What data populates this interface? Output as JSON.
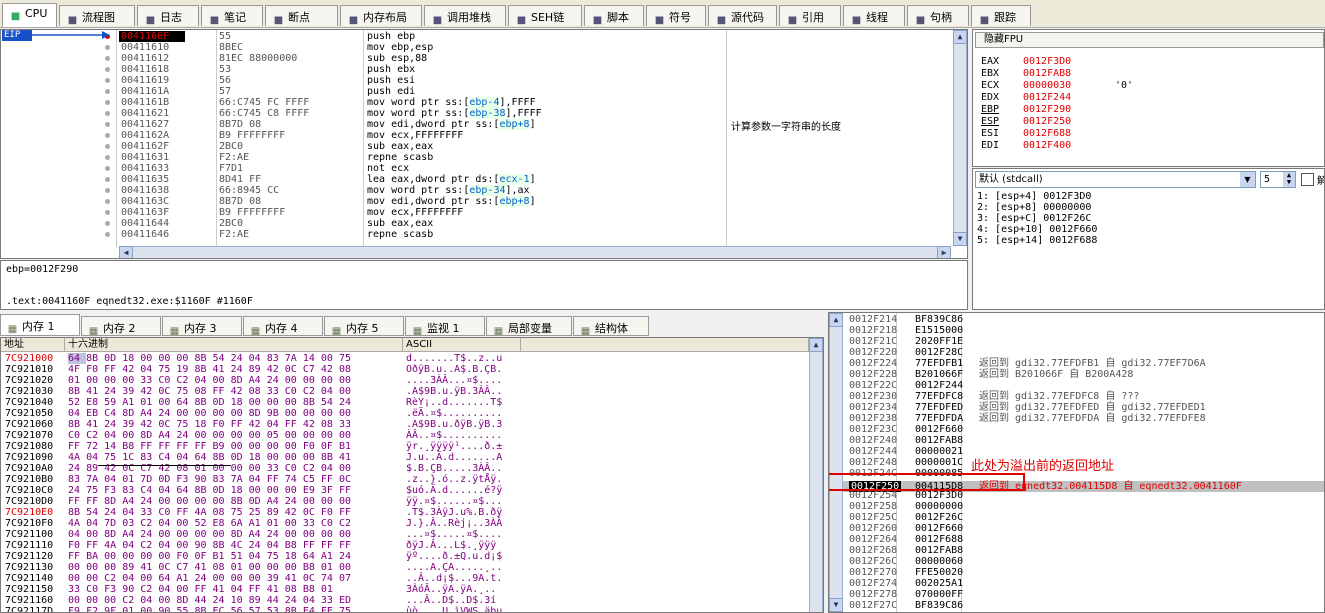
{
  "toolbar": {
    "tabs": [
      {
        "label": "CPU",
        "icon": "cpu-icon"
      },
      {
        "label": "流程图",
        "icon": "flow-icon"
      },
      {
        "label": "日志",
        "icon": "log-icon"
      },
      {
        "label": "笔记",
        "icon": "note-icon"
      },
      {
        "label": "断点",
        "icon": "breakpoint-icon"
      },
      {
        "label": "内存布局",
        "icon": "memory-map-icon"
      },
      {
        "label": "调用堆栈",
        "icon": "callstack-icon"
      },
      {
        "label": "SEH链",
        "icon": "seh-icon"
      },
      {
        "label": "脚本",
        "icon": "script-icon"
      },
      {
        "label": "符号",
        "icon": "symbol-icon"
      },
      {
        "label": "源代码",
        "icon": "source-icon"
      },
      {
        "label": "引用",
        "icon": "reference-icon"
      },
      {
        "label": "线程",
        "icon": "thread-icon"
      },
      {
        "label": "句柄",
        "icon": "handle-icon"
      },
      {
        "label": "跟踪",
        "icon": "trace-icon"
      }
    ]
  },
  "disasm": {
    "eip_label": "EIP",
    "comment": "计算参数一字符串的长度",
    "rows": [
      {
        "addr": "0041160F",
        "bytes": "55",
        "instr": "push ebp"
      },
      {
        "addr": "00411610",
        "bytes": "8BEC",
        "instr": "mov ebp,esp"
      },
      {
        "addr": "00411612",
        "bytes": "81EC 88000000",
        "instr": "sub esp,88"
      },
      {
        "addr": "00411618",
        "bytes": "53",
        "instr": "push ebx"
      },
      {
        "addr": "00411619",
        "bytes": "56",
        "instr": "push esi"
      },
      {
        "addr": "0041161A",
        "bytes": "57",
        "instr": "push edi"
      },
      {
        "addr": "0041161B",
        "bytes": "66:C745 FC FFFF",
        "instr": "mov word ptr ss:[ebp-4],FFFF"
      },
      {
        "addr": "00411621",
        "bytes": "66:C745 C8 FFFF",
        "instr": "mov word ptr ss:[ebp-38],FFFF"
      },
      {
        "addr": "00411627",
        "bytes": "8B7D 08",
        "instr": "mov edi,dword ptr ss:[ebp+8]"
      },
      {
        "addr": "0041162A",
        "bytes": "B9 FFFFFFFF",
        "instr": "mov ecx,FFFFFFFF"
      },
      {
        "addr": "0041162F",
        "bytes": "2BC0",
        "instr": "sub eax,eax"
      },
      {
        "addr": "00411631",
        "bytes": "F2:AE",
        "instr": "repne scasb"
      },
      {
        "addr": "00411633",
        "bytes": "F7D1",
        "instr": "not ecx"
      },
      {
        "addr": "00411635",
        "bytes": "8D41 FF",
        "instr": "lea eax,dword ptr ds:[ecx-1]"
      },
      {
        "addr": "00411638",
        "bytes": "66:8945 CC",
        "instr": "mov word ptr ss:[ebp-34],ax"
      },
      {
        "addr": "0041163C",
        "bytes": "8B7D 08",
        "instr": "mov edi,dword ptr ss:[ebp+8]"
      },
      {
        "addr": "0041163F",
        "bytes": "B9 FFFFFFFF",
        "instr": "mov ecx,FFFFFFFF"
      },
      {
        "addr": "00411644",
        "bytes": "2BC0",
        "instr": "sub eax,eax"
      },
      {
        "addr": "00411646",
        "bytes": "F2:AE",
        "instr": "repne scasb"
      }
    ]
  },
  "info": {
    "line1": "ebp=0012F290",
    "line2": ".text:0041160F eqnedt32.exe:$1160F #1160F"
  },
  "registers": {
    "header": "隐藏FPU",
    "rows": [
      {
        "name": "EAX",
        "value": "0012F3D0",
        "extra": ""
      },
      {
        "name": "EBX",
        "value": "0012FAB8",
        "extra": ""
      },
      {
        "name": "ECX",
        "value": "00000030",
        "extra": "'0'"
      },
      {
        "name": "EDX",
        "value": "0012F244",
        "extra": ""
      },
      {
        "name": "EBP",
        "value": "0012F290",
        "extra": ""
      },
      {
        "name": "ESP",
        "value": "0012F250",
        "extra": ""
      },
      {
        "name": "ESI",
        "value": "0012F688",
        "extra": ""
      },
      {
        "name": "EDI",
        "value": "0012F400",
        "extra": ""
      }
    ]
  },
  "callconv": {
    "selected": "默认 (stdcall)",
    "count": "5",
    "args": [
      "1: [esp+4] 0012F3D0",
      "2: [esp+8] 00000000",
      "3: [esp+C] 0012F26C",
      "4: [esp+10] 0012F660",
      "5: [esp+14] 0012F688"
    ]
  },
  "bottom_tabs": [
    {
      "label": "内存 1"
    },
    {
      "label": "内存 2"
    },
    {
      "label": "内存 3"
    },
    {
      "label": "内存 4"
    },
    {
      "label": "内存 5"
    },
    {
      "label": "监视 1"
    },
    {
      "label": "局部变量"
    },
    {
      "label": "结构体"
    }
  ],
  "dump": {
    "col_addr": "地址",
    "col_hex": "十六进制",
    "col_ascii": "ASCII",
    "rows": [
      {
        "addr": "7C921000",
        "hex": "64 8B 0D 18 00 00 00 8B 54 24 04 83 7A 14 00 75",
        "ascii": "d.......T$..z..u"
      },
      {
        "addr": "7C921010",
        "hex": "4F F0 FF 42 04 75 19 8B 41 24 89 42 0C C7 42 08",
        "ascii": "OðÿB.u..A$.B.ÇB."
      },
      {
        "addr": "7C921020",
        "hex": "01 00 00 00 33 C0 C2 04 00 8D A4 24 00 00 00 00",
        "ascii": "....3ÀÂ...¤$...."
      },
      {
        "addr": "7C921030",
        "hex": "8B 41 24 39 42 0C 75 08 FF 42 08 33 C0 C2 04 00",
        "ascii": ".A$9B.u.ÿB.3ÀÂ.."
      },
      {
        "addr": "7C921040",
        "hex": "52 E8 59 A1 01 00 64 8B 0D 18 00 00 00 8B 54 24",
        "ascii": "RèY¡..d.......T$"
      },
      {
        "addr": "7C921050",
        "hex": "04 EB C4 8D A4 24 00 00 00 00 8D 9B 00 00 00 00",
        "ascii": ".ëÄ.¤$.........."
      },
      {
        "addr": "7C921060",
        "hex": "8B 41 24 39 42 0C 75 18 F0 FF 42 04 FF 42 08 33",
        "ascii": ".A$9B.u.ðÿB.ÿB.3"
      },
      {
        "addr": "7C921070",
        "hex": "C0 C2 04 00 8D A4 24 00 00 00 00 05 00 00 00 00",
        "ascii": "ÀÂ..¤$.........."
      },
      {
        "addr": "7C921080",
        "hex": "FF 72 14 B8 FF FF FF FF B9 00 00 00 00 F0 0F B1",
        "ascii": "ÿr.¸ÿÿÿÿ¹....ð.±"
      },
      {
        "addr": "7C921090",
        "hex": "4A 04 75 1C 83 C4 04 64 8B 0D 18 00 00 00 8B 41",
        "ascii": "J.u..Ä.d.......A"
      },
      {
        "addr": "7C9210A0",
        "hex": "24 89 42 0C C7 42 08 01 00 00 00 33 C0 C2 04 00",
        "ascii": "$.B.ÇB.....3ÀÂ.."
      },
      {
        "addr": "7C9210B0",
        "hex": "83 7A 04 01 7D 0D F3 90 83 7A 04 FF 74 C5 FF 0C",
        "ascii": ".z..}.ó..z.ÿtÅÿ."
      },
      {
        "addr": "7C9210C0",
        "hex": "24 75 F3 83 C4 04 64 8B 0D 18 00 00 00 E9 3F FF",
        "ascii": "$uó.Ä.d......é?ÿ"
      },
      {
        "addr": "7C9210D0",
        "hex": "FF FF 8D A4 24 00 00 00 00 8B 0D A4 24 00 00 00",
        "ascii": "ÿÿ.¤$......¤$..."
      },
      {
        "addr": "7C9210E0",
        "hex": "8B 54 24 04 33 C0 FF 4A 08 75 25 89 42 0C F0 FF",
        "ascii": ".T$.3ÀÿJ.u%.B.ðÿ"
      },
      {
        "addr": "7C9210F0",
        "hex": "4A 04 7D 03 C2 04 00 52 E8 6A A1 01 00 33 C0 C2",
        "ascii": "J.}.Â..Rèj¡..3ÀÂ"
      },
      {
        "addr": "7C921100",
        "hex": "04 00 8D A4 24 00 00 00 00 8D A4 24 00 00 00 00",
        "ascii": "...¤$.....¤$...."
      },
      {
        "addr": "7C921110",
        "hex": "F0 FF 4A 04 C2 04 00 90 8B 4C 24 04 B8 FF FF FF",
        "ascii": "ðÿJ.Â...L$.¸ÿÿÿ"
      },
      {
        "addr": "7C921120",
        "hex": "FF BA 00 00 00 00 F0 0F B1 51 04 75 18 64 A1 24",
        "ascii": "ÿº....ð.±Q.u.d¡$"
      },
      {
        "addr": "7C921130",
        "hex": "00 00 00 89 41 0C C7 41 08 01 00 00 00 B8 01 00",
        "ascii": "....A.ÇA.....¸.."
      },
      {
        "addr": "7C921140",
        "hex": "00 00 C2 04 00 64 A1 24 00 00 00 39 41 0C 74 07",
        "ascii": "..Â..d¡$...9A.t."
      },
      {
        "addr": "7C921150",
        "hex": "33 C0 F3 90 C2 04 00 FF 41 04 FF 41 08 B8 01",
        "ascii": "3ÀóÂ..ÿA.ÿA.¸.."
      },
      {
        "addr": "7C921160",
        "hex": "00 00 00 C2 04 00 8D 44 24 10 89 44 24 04 33 ED",
        "ascii": "...Â..D$..D$.3í"
      },
      {
        "addr": "7C92117D",
        "hex": "F9 F2 9F 01 00 90 55 8B EC 56 57 53 8B E4 FE 75",
        "ascii": "ùò....U.ìVWS.äþu"
      }
    ]
  },
  "stack": {
    "annotation": "此处为溢出前的返回地址",
    "rows": [
      {
        "addr": "0012F214",
        "value": "BF839C86",
        "comment": ""
      },
      {
        "addr": "0012F218",
        "value": "E1515000",
        "comment": ""
      },
      {
        "addr": "0012F21C",
        "value": "2020FF1E",
        "comment": ""
      },
      {
        "addr": "0012F220",
        "value": "0012F28C",
        "comment": ""
      },
      {
        "addr": "0012F224",
        "value": "77EFDFB1",
        "comment": "返回到 gdi32.77EFDFB1 自 gdi32.77EF7D6A"
      },
      {
        "addr": "0012F228",
        "value": "B201066F",
        "comment": "返回到 B201066F 自 B200A428"
      },
      {
        "addr": "0012F22C",
        "value": "0012F244",
        "comment": ""
      },
      {
        "addr": "0012F230",
        "value": "77EFDFC8",
        "comment": "返回到 gdi32.77EFDFC8 自 ???"
      },
      {
        "addr": "0012F234",
        "value": "77EFDFED",
        "comment": "返回到 gdi32.77EFDFED 自 gdi32.77EFDED1"
      },
      {
        "addr": "0012F238",
        "value": "77EFDFDA",
        "comment": "返回到 gdi32.77EFDFDA 自 gdi32.77EFDFE8"
      },
      {
        "addr": "0012F23C",
        "value": "0012F660",
        "comment": ""
      },
      {
        "addr": "0012F240",
        "value": "0012FAB8",
        "comment": ""
      },
      {
        "addr": "0012F244",
        "value": "00000021",
        "comment": ""
      },
      {
        "addr": "0012F248",
        "value": "0000001C",
        "comment": ""
      },
      {
        "addr": "0012F24C",
        "value": "00000085",
        "comment": ""
      },
      {
        "addr": "0012F250",
        "value": "004115D8",
        "comment": "返回到 eqnedt32.004115D8 自 eqnedt32.0041160F"
      },
      {
        "addr": "0012F254",
        "value": "0012F3D0",
        "comment": ""
      },
      {
        "addr": "0012F258",
        "value": "00000000",
        "comment": ""
      },
      {
        "addr": "0012F25C",
        "value": "0012F26C",
        "comment": ""
      },
      {
        "addr": "0012F260",
        "value": "0012F660",
        "comment": ""
      },
      {
        "addr": "0012F264",
        "value": "0012F688",
        "comment": ""
      },
      {
        "addr": "0012F268",
        "value": "0012FAB8",
        "comment": ""
      },
      {
        "addr": "0012F26C",
        "value": "00000060",
        "comment": ""
      },
      {
        "addr": "0012F270",
        "value": "FFE50020",
        "comment": ""
      },
      {
        "addr": "0012F274",
        "value": "002025A1",
        "comment": ""
      },
      {
        "addr": "0012F278",
        "value": "070000FF",
        "comment": ""
      },
      {
        "addr": "0012F27C",
        "value": "BF839C86",
        "comment": ""
      }
    ]
  },
  "colors": {
    "highlight": "#c00000",
    "selection": "#000000",
    "accent": "#0000ff"
  }
}
